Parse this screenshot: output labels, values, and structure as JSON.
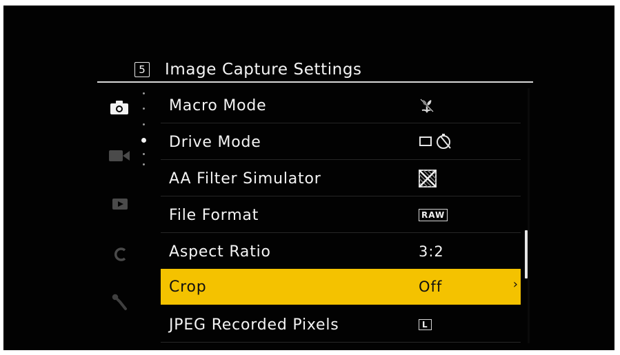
{
  "header": {
    "page_number": "5",
    "title": "Image Capture Settings"
  },
  "tabs": [
    {
      "name": "camera-tab",
      "icon": "camera-icon",
      "active": true
    },
    {
      "name": "movie-tab",
      "icon": "video-camera-icon",
      "active": false
    },
    {
      "name": "playback-tab",
      "icon": "playback-icon",
      "active": false
    },
    {
      "name": "custom-tab",
      "icon": "custom-c-icon",
      "active": false
    },
    {
      "name": "setup-tab",
      "icon": "wrench-icon",
      "active": false
    }
  ],
  "page_indicator": {
    "pages": 5,
    "active": 3
  },
  "menu": {
    "items": [
      {
        "label": "Macro Mode",
        "value_icon": "macro-off-icon"
      },
      {
        "label": "Drive Mode",
        "value_icon": "single-frame-self-timer-icon"
      },
      {
        "label": "AA Filter Simulator",
        "value_icon": "aa-filter-off-icon"
      },
      {
        "label": "File Format",
        "value": "RAW"
      },
      {
        "label": "Aspect Ratio",
        "value": "3:2"
      },
      {
        "label": "Crop",
        "value": "Off",
        "selected": true
      },
      {
        "label": "JPEG Recorded Pixels",
        "value": "L"
      }
    ]
  },
  "colors": {
    "background": "#020202",
    "highlight": "#f4c200",
    "text": "#f4f4f4",
    "inactive_icon": "#5a5a5a"
  }
}
